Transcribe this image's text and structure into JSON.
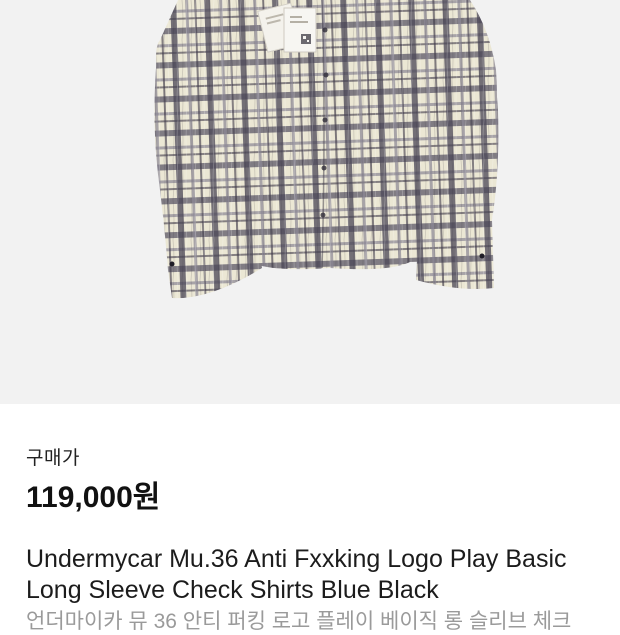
{
  "product": {
    "image_alt_icon": "shirt-photo",
    "price_label": "구매가",
    "price": "119,000원",
    "title": "Undermycar Mu.36 Anti Fxxking Logo Play Basic Long Sleeve Check Shirts Blue Black",
    "subtitle": "언더마이카 뮤 36 안티 퍼킹 로고 플레이 베이직 롱 슬리브 체크"
  },
  "colors": {
    "image_bg": "#f2f2f2",
    "shirt_base": "#e9e5d2",
    "check_dark": "#4a4656",
    "check_mid": "#8b8694"
  }
}
